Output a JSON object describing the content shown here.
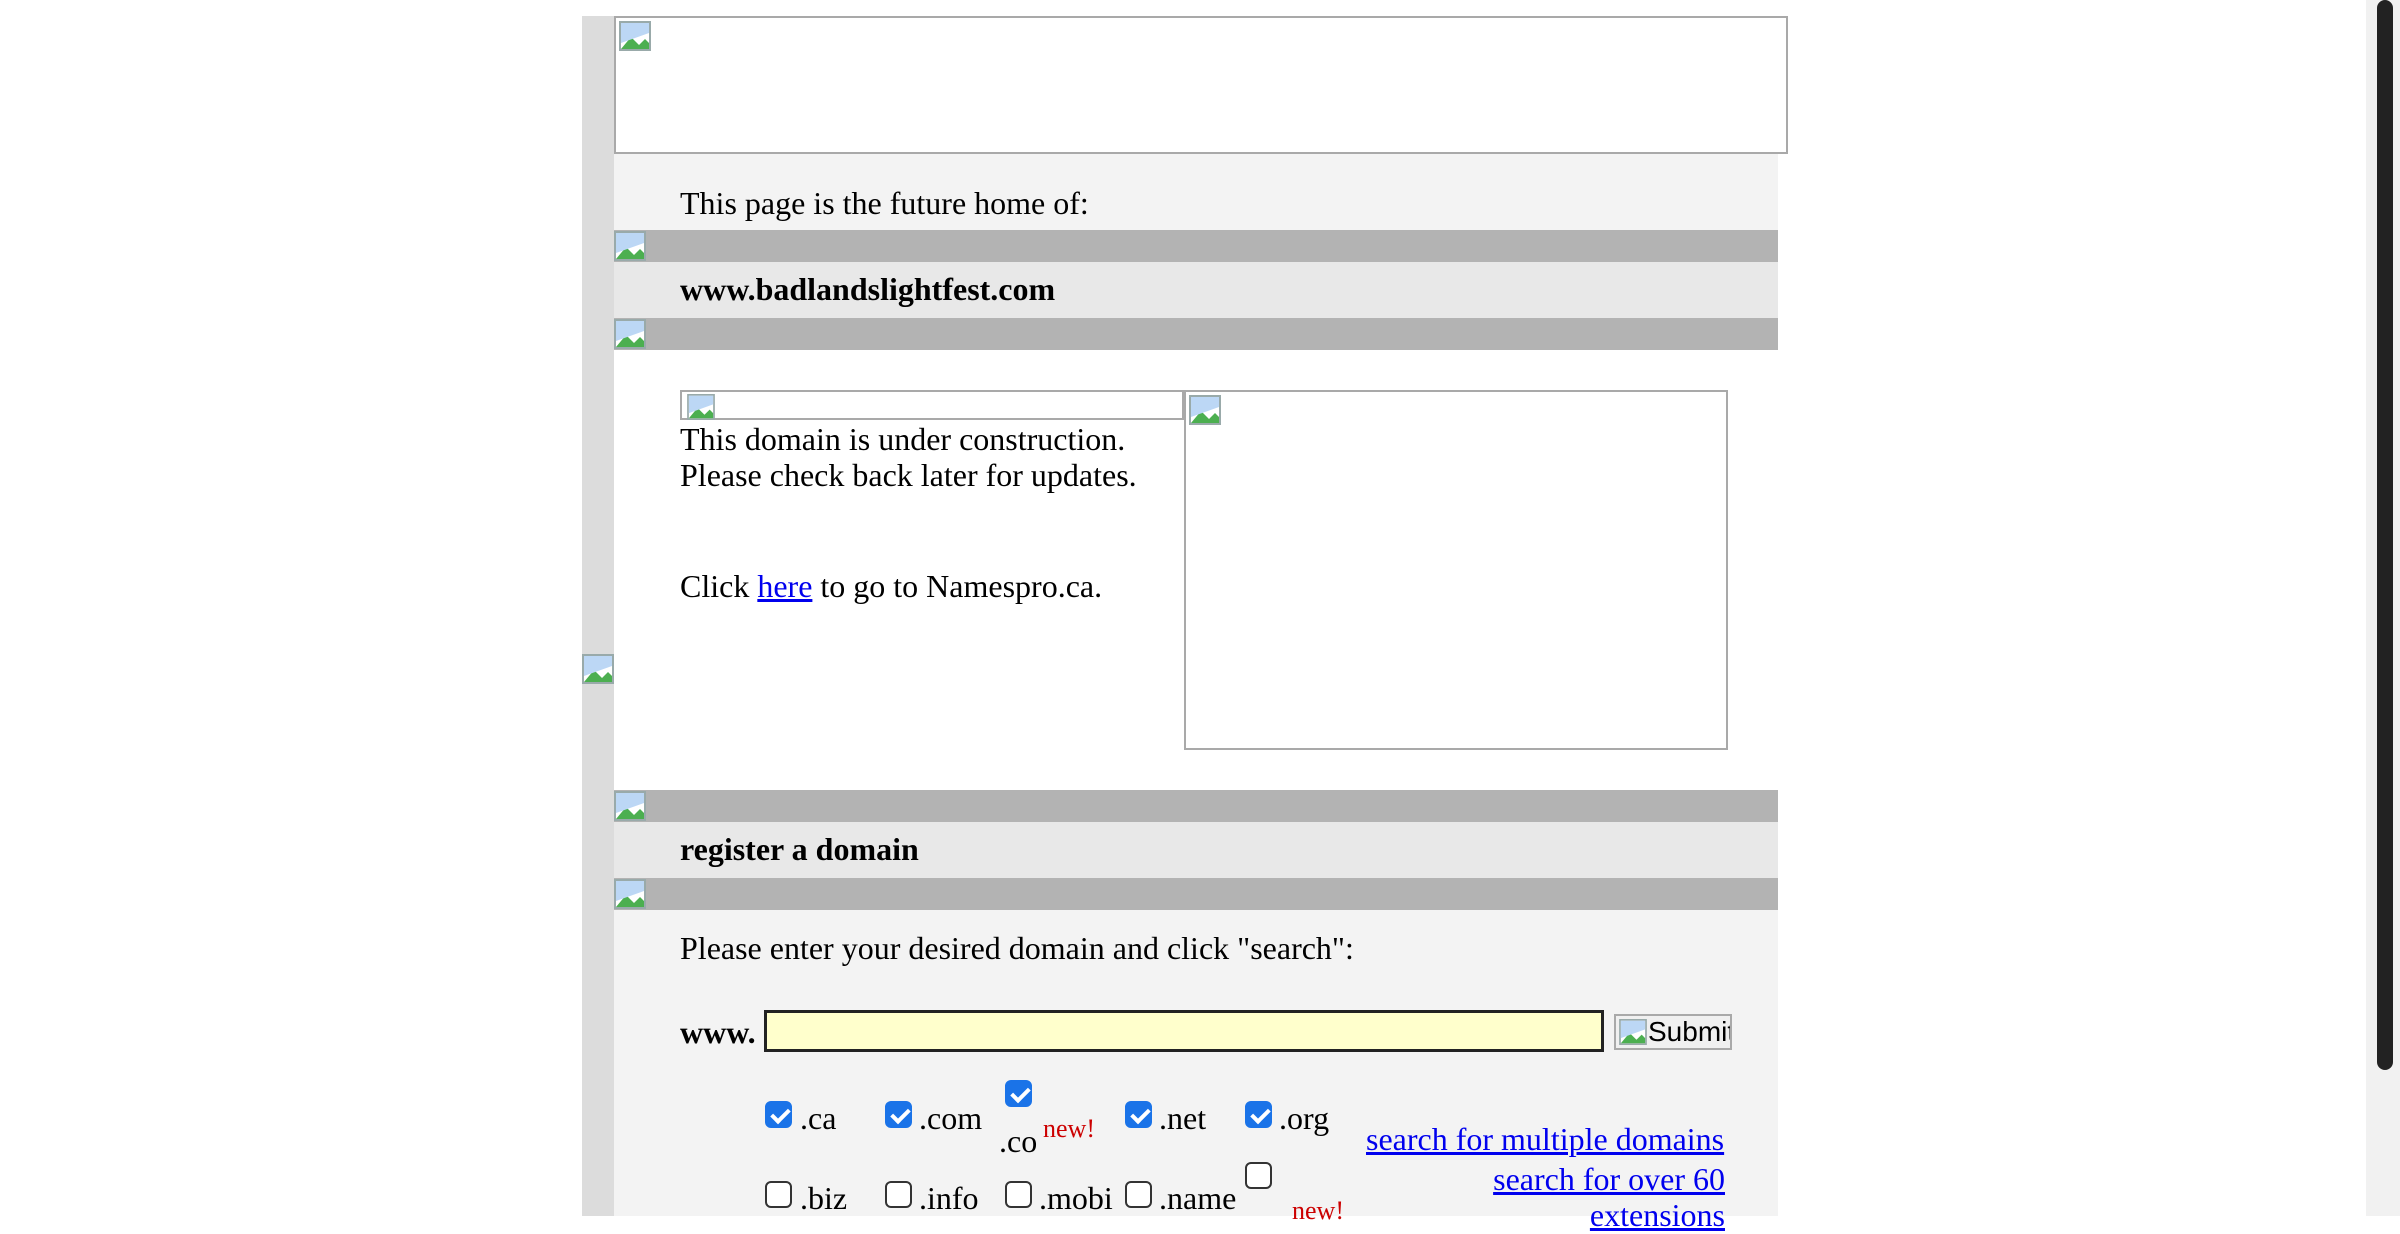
{
  "intro": {
    "future_home": "This page is the future home of:",
    "domain": "www.badlandslightfest.com"
  },
  "construction": {
    "line1": "This domain is under construction.",
    "line2": "Please check back later for updates.",
    "click_prefix": "Click",
    "here_link": "here",
    "click_suffix": "to go to Namespro.ca."
  },
  "register": {
    "heading": "register a domain",
    "instructions": "Please enter your desired domain and click \"search\":",
    "www_label": "www.",
    "search_value": "",
    "submit_alt": "Submit"
  },
  "extensions": [
    {
      "label": ".ca",
      "checked": true
    },
    {
      "label": ".com",
      "checked": true
    },
    {
      "label": ".co",
      "checked": true,
      "badge": "new!"
    },
    {
      "label": ".net",
      "checked": true
    },
    {
      "label": ".org",
      "checked": true
    },
    {
      "label": ".biz",
      "checked": false
    },
    {
      "label": ".info",
      "checked": false
    },
    {
      "label": ".mobi",
      "checked": false
    },
    {
      "label": ".name",
      "checked": false
    },
    {
      "label": "",
      "checked": false,
      "badge": "new!"
    }
  ],
  "links": {
    "multiple_domains": "search for multiple domains",
    "over_60_line1": "search for over 60",
    "over_60_line2": "extensions"
  },
  "colors": {
    "link": "#0000ee",
    "input_bg": "#ffffcc",
    "badge": "#cc0000",
    "checkbox": "#1a73e8"
  },
  "icons": [
    "broken-image-icon",
    "checkbox-checked-icon",
    "checkbox-unchecked-icon"
  ]
}
